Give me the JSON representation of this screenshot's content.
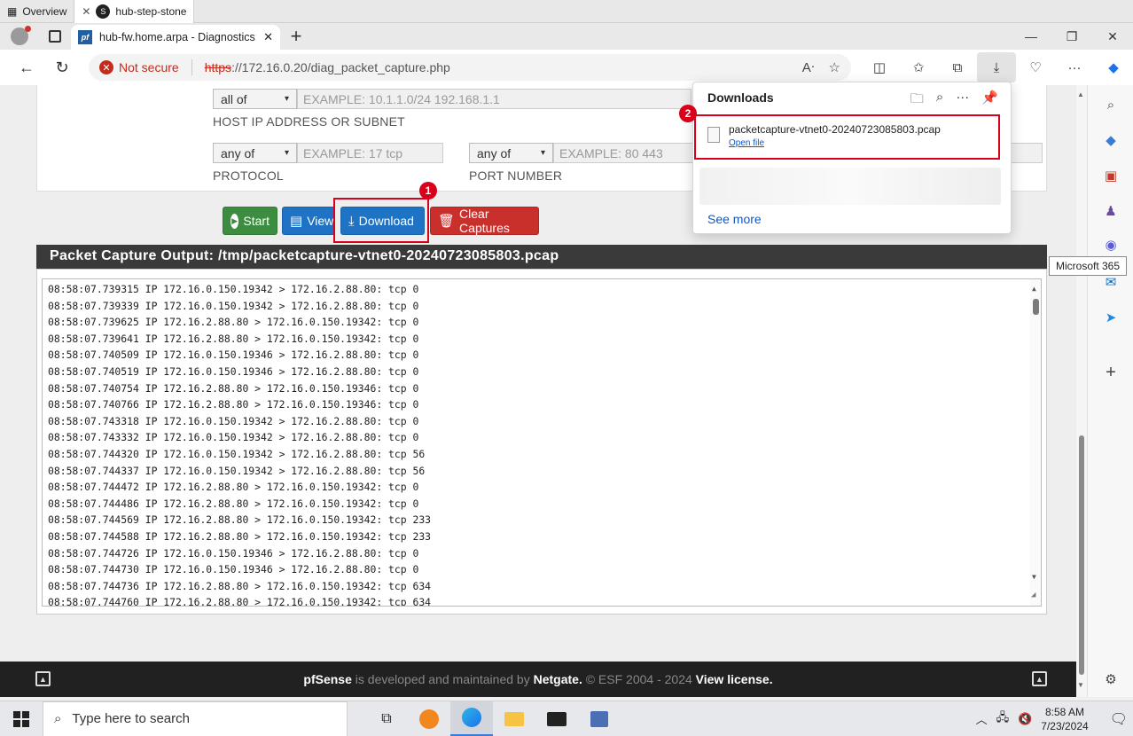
{
  "host_tabs": [
    {
      "label": "Overview"
    },
    {
      "label": "hub-step-stone"
    }
  ],
  "browser_tab": {
    "title": "hub-fw.home.arpa - Diagnostics:"
  },
  "address": {
    "security_label": "Not secure",
    "url_scheme": "https",
    "url_rest": "://172.16.0.20/diag_packet_capture.php"
  },
  "filters": {
    "host_match": "all of",
    "host_placeholder": "EXAMPLE: 10.1.1.0/24 192.168.1.1",
    "host_label": "HOST IP ADDRESS OR SUBNET",
    "protocol_match": "any of",
    "protocol_placeholder": "EXAMPLE: 17 tcp",
    "protocol_label": "PROTOCOL",
    "port_match": "any of",
    "port_placeholder": "EXAMPLE: 80 443",
    "port_label": "PORT NUMBER"
  },
  "buttons": {
    "start": "Start",
    "view": "View",
    "download": "Download",
    "clear": "Clear Captures"
  },
  "annotations": {
    "one": "1",
    "two": "2"
  },
  "output": {
    "header": "Packet Capture Output: /tmp/packetcapture-vtnet0-20240723085803.pcap",
    "lines": [
      "08:58:07.739315 IP 172.16.0.150.19342 > 172.16.2.88.80: tcp 0",
      "08:58:07.739339 IP 172.16.0.150.19342 > 172.16.2.88.80: tcp 0",
      "08:58:07.739625 IP 172.16.2.88.80 > 172.16.0.150.19342: tcp 0",
      "08:58:07.739641 IP 172.16.2.88.80 > 172.16.0.150.19342: tcp 0",
      "08:58:07.740509 IP 172.16.0.150.19346 > 172.16.2.88.80: tcp 0",
      "08:58:07.740519 IP 172.16.0.150.19346 > 172.16.2.88.80: tcp 0",
      "08:58:07.740754 IP 172.16.2.88.80 > 172.16.0.150.19346: tcp 0",
      "08:58:07.740766 IP 172.16.2.88.80 > 172.16.0.150.19346: tcp 0",
      "08:58:07.743318 IP 172.16.0.150.19342 > 172.16.2.88.80: tcp 0",
      "08:58:07.743332 IP 172.16.0.150.19342 > 172.16.2.88.80: tcp 0",
      "08:58:07.744320 IP 172.16.0.150.19342 > 172.16.2.88.80: tcp 56",
      "08:58:07.744337 IP 172.16.0.150.19342 > 172.16.2.88.80: tcp 56",
      "08:58:07.744472 IP 172.16.2.88.80 > 172.16.0.150.19342: tcp 0",
      "08:58:07.744486 IP 172.16.2.88.80 > 172.16.0.150.19342: tcp 0",
      "08:58:07.744569 IP 172.16.2.88.80 > 172.16.0.150.19342: tcp 233",
      "08:58:07.744588 IP 172.16.2.88.80 > 172.16.0.150.19342: tcp 233",
      "08:58:07.744726 IP 172.16.0.150.19346 > 172.16.2.88.80: tcp 0",
      "08:58:07.744730 IP 172.16.0.150.19346 > 172.16.2.88.80: tcp 0",
      "08:58:07.744736 IP 172.16.2.88.80 > 172.16.0.150.19342: tcp 634",
      "08:58:07.744760 IP 172.16.2.88.80 > 172.16.0.150.19342: tcp 634"
    ]
  },
  "footer": {
    "brand": "pfSense",
    "text1": " is developed and maintained by ",
    "company": "Netgate.",
    "text2": " © ESF 2004 - 2024 ",
    "license": "View license."
  },
  "downloads": {
    "title": "Downloads",
    "file_name": "packetcapture-vtnet0-20240723085803.pcap",
    "open_file": "Open file",
    "see_more": "See more"
  },
  "tooltip": "Microsoft 365",
  "taskbar": {
    "search_placeholder": "Type here to search",
    "time": "8:58 AM",
    "date": "7/23/2024"
  },
  "colors": {
    "annotation_red": "#d9001b",
    "pfsense_dark": "#212121",
    "btn_green": "#3c8d3f",
    "btn_blue": "#1e73c4",
    "btn_red": "#c9302c",
    "link_blue": "#0a58ca"
  }
}
